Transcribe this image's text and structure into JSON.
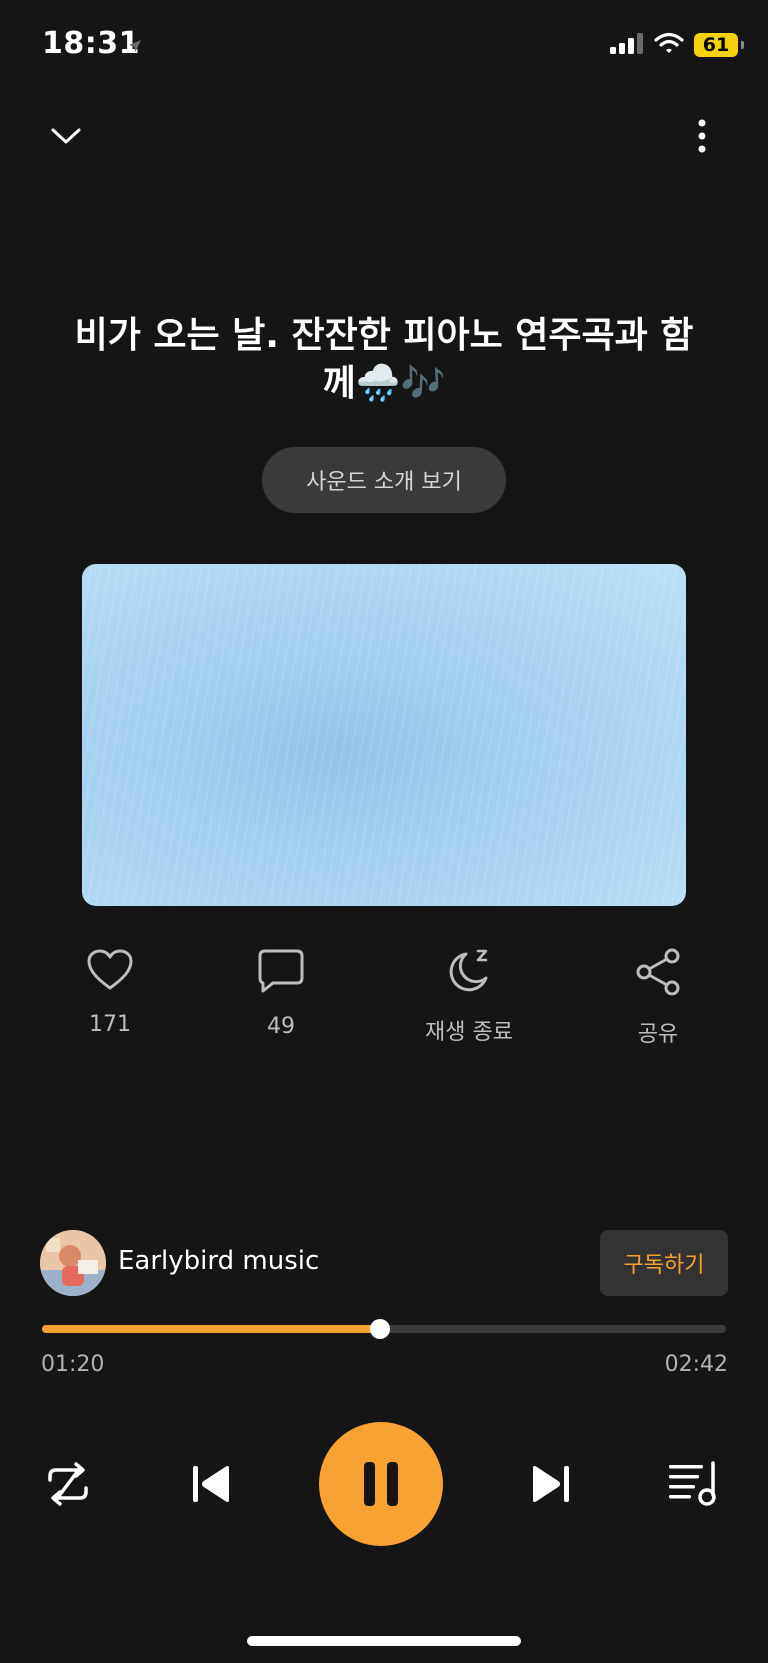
{
  "status_bar": {
    "time": "18:31",
    "battery": "61"
  },
  "track": {
    "title": "비가 오는 날. 잔잔한 피아노 연주곡과 함께🌧️🎶",
    "intro_button": "사운드 소개 보기"
  },
  "actions": {
    "likes": "171",
    "comments": "49",
    "sleep_timer": "재생 종료",
    "share": "공유"
  },
  "channel": {
    "name": "Earlybird music",
    "subscribe": "구독하기"
  },
  "playback": {
    "current_time": "01:20",
    "total_time": "02:42",
    "progress": 0.494
  },
  "colors": {
    "accent": "#f7a233",
    "background": "#151515"
  },
  "icons": {
    "collapse": "chevron-down-icon",
    "more": "more-vertical-icon",
    "like": "heart-icon",
    "comment": "comment-icon",
    "sleep": "moon-sleep-icon",
    "share": "share-icon",
    "repeat": "repeat-icon",
    "previous": "skip-previous-icon",
    "pause": "pause-icon",
    "next": "skip-next-icon",
    "queue": "playlist-icon"
  }
}
